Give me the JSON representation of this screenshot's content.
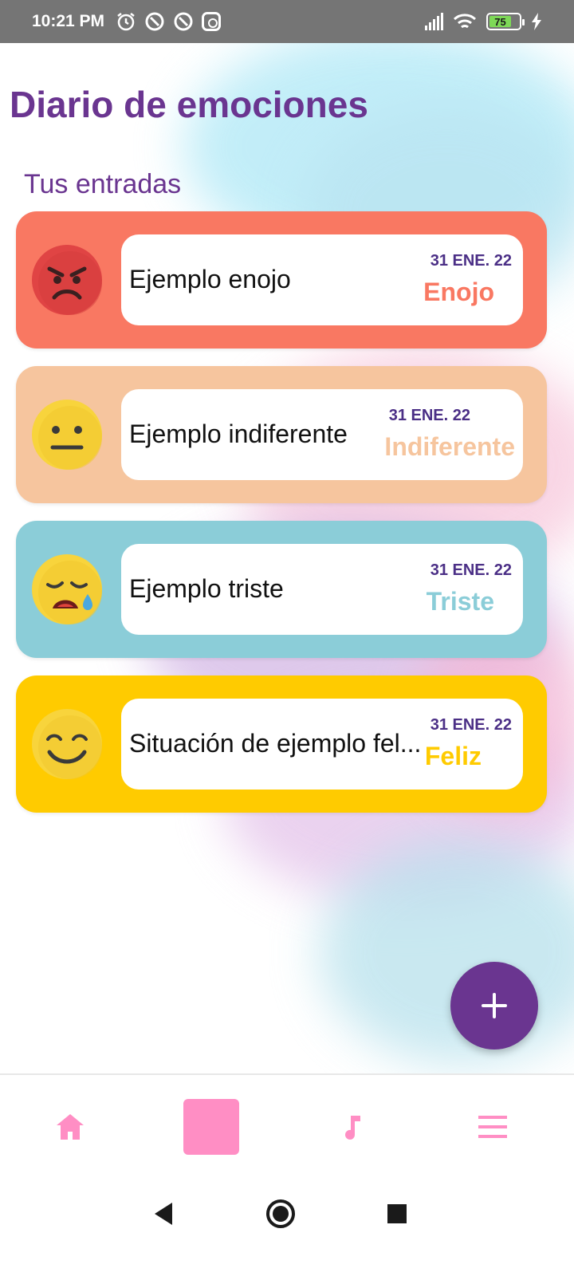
{
  "status_bar": {
    "time": "10:21 PM",
    "battery": "75",
    "icons": [
      "alarm-icon",
      "notification-icon",
      "notification-icon",
      "instagram-icon",
      "signal-icon",
      "wifi-icon",
      "battery-icon",
      "charging-icon"
    ]
  },
  "page": {
    "title": "Diario de emociones",
    "subtitle": "Tus entradas"
  },
  "entries": [
    {
      "text": "Ejemplo enojo",
      "date": "31 ENE. 22",
      "mood": "Enojo",
      "emoji": "angry-face-icon",
      "bg": "#f97862",
      "mood_color": "#f97862"
    },
    {
      "text": "Ejemplo indiferente",
      "date": "31 ENE. 22",
      "mood": "Indiferente",
      "emoji": "neutral-face-icon",
      "bg": "#f6c59e",
      "mood_color": "#f6c59e"
    },
    {
      "text": "Ejemplo triste",
      "date": "31 ENE. 22",
      "mood": "Triste",
      "emoji": "sad-face-icon",
      "bg": "#8bcdd8",
      "mood_color": "#8bcdd8"
    },
    {
      "text": "Situación de ejemplo fel...",
      "date": "31 ENE. 22",
      "mood": "Feliz",
      "emoji": "happy-face-icon",
      "bg": "#ffcb00",
      "mood_color": "#ffcb00"
    }
  ],
  "fab": {
    "icon": "plus-icon"
  },
  "bottom_nav": [
    {
      "icon": "home-icon",
      "active": false
    },
    {
      "icon": "moon-icon",
      "active": true
    },
    {
      "icon": "music-note-icon",
      "active": false
    },
    {
      "icon": "menu-icon",
      "active": false
    }
  ],
  "colors": {
    "primary": "#6a3590",
    "accent_pink": "#ff8ec4",
    "date_color": "#4b2f86"
  }
}
